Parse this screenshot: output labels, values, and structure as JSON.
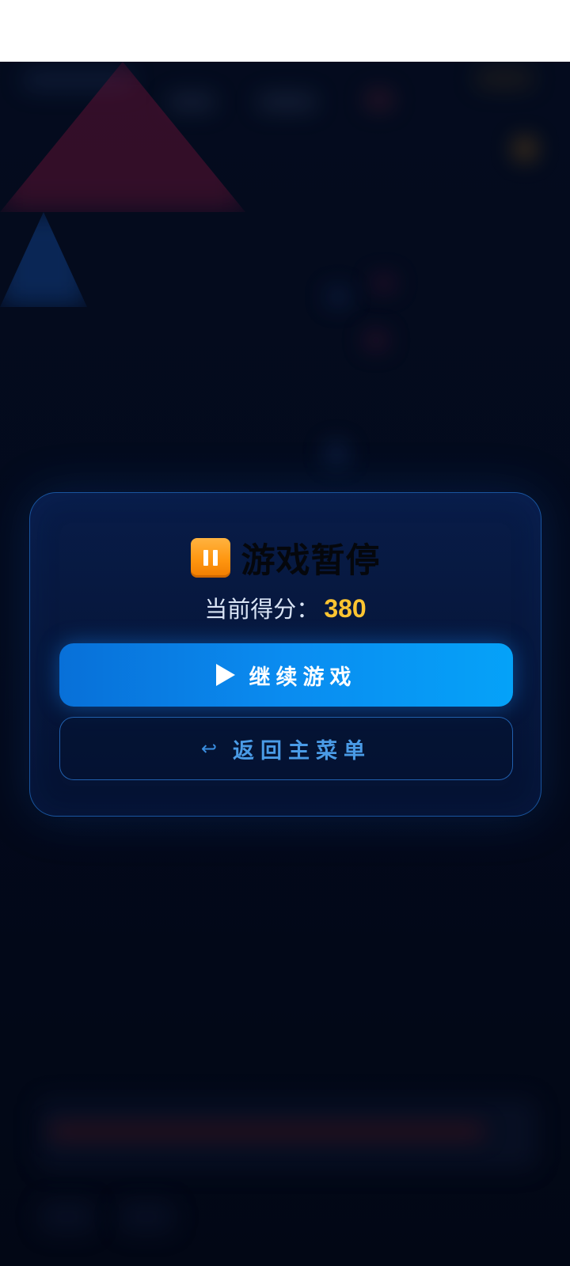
{
  "pause_dialog": {
    "title": "游戏暂停",
    "title_icon": "pause-icon",
    "score_label": "当前得分：",
    "score_value": "380",
    "resume_button": {
      "icon": "play-icon",
      "label": "继续游戏"
    },
    "menu_button": {
      "icon": "return-arrow-icon",
      "icon_glyph": "↩",
      "label": "返回主菜单"
    }
  },
  "colors": {
    "score_value": "#ffc531",
    "resume_button": "#0a8cf0",
    "menu_button_text": "#4a9be6",
    "pause_icon": "#ff9610",
    "panel_border": "#1c5caa"
  }
}
